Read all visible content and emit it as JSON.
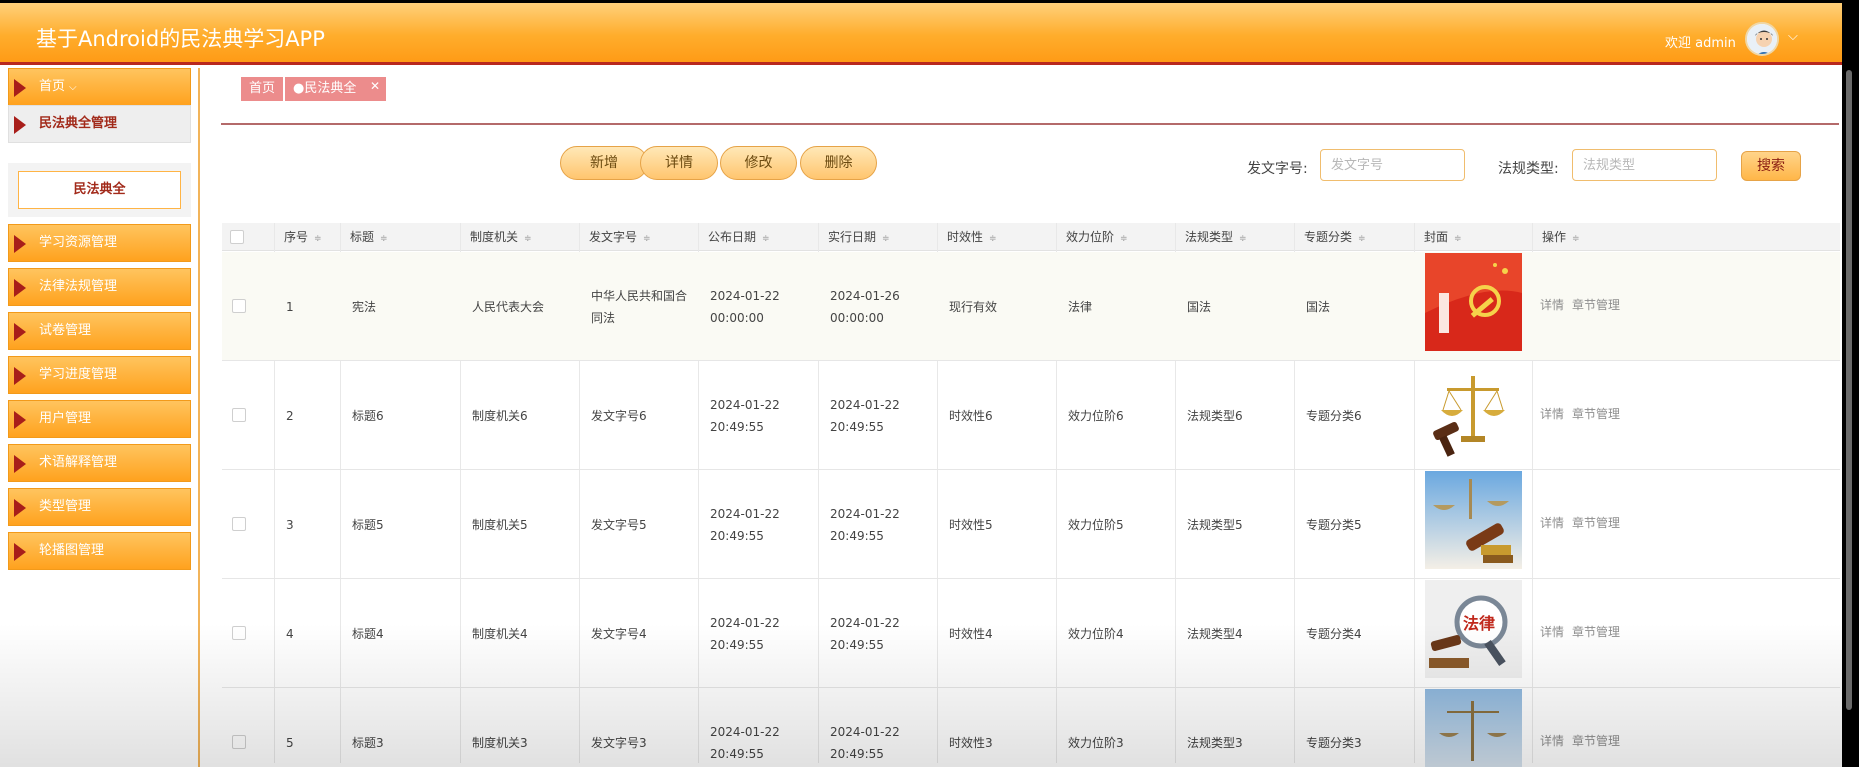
{
  "header": {
    "title": "基于Android的民法典学习APP",
    "welcome": "欢迎 admin",
    "caret": "⌵"
  },
  "sidebar": {
    "items": [
      {
        "label": "首页",
        "caret": "⌵"
      },
      {
        "label": "民法典全管理"
      },
      {
        "label": "学习资源管理"
      },
      {
        "label": "法律法规管理"
      },
      {
        "label": "试卷管理"
      },
      {
        "label": "学习进度管理"
      },
      {
        "label": "用户管理"
      },
      {
        "label": "术语解释管理"
      },
      {
        "label": "类型管理"
      },
      {
        "label": "轮播图管理"
      }
    ],
    "sub_item": "民法典全"
  },
  "breadcrumb": {
    "home": "首页",
    "current": "●民法典全",
    "close": "✕"
  },
  "toolbar": {
    "add": "新增",
    "detail": "详情",
    "edit": "修改",
    "delete": "删除"
  },
  "search": {
    "doc_no_label": "发文字号:",
    "doc_no_placeholder": "发文字号",
    "law_type_label": "法规类型:",
    "law_type_placeholder": "法规类型",
    "button": "搜索"
  },
  "table": {
    "columns": [
      "序号",
      "标题",
      "制度机关",
      "发文字号",
      "公布日期",
      "实行日期",
      "时效性",
      "效力位阶",
      "法规类型",
      "专题分类",
      "封面",
      "操作"
    ],
    "sort_icon": "≑",
    "op_detail": "详情",
    "op_chapter": "章节管理",
    "rows": [
      {
        "no": "1",
        "title": "宪法",
        "org": "人民代表大会",
        "docno": "中华人民共和国合同法",
        "pub": "2024-01-22 00:00:00",
        "impl": "2024-01-26 00:00:00",
        "valid": "现行有效",
        "level": "法律",
        "type": "国法",
        "topic": "国法"
      },
      {
        "no": "2",
        "title": "标题6",
        "org": "制度机关6",
        "docno": "发文字号6",
        "pub": "2024-01-22 20:49:55",
        "impl": "2024-01-22 20:49:55",
        "valid": "时效性6",
        "level": "效力位阶6",
        "type": "法规类型6",
        "topic": "专题分类6"
      },
      {
        "no": "3",
        "title": "标题5",
        "org": "制度机关5",
        "docno": "发文字号5",
        "pub": "2024-01-22 20:49:55",
        "impl": "2024-01-22 20:49:55",
        "valid": "时效性5",
        "level": "效力位阶5",
        "type": "法规类型5",
        "topic": "专题分类5"
      },
      {
        "no": "4",
        "title": "标题4",
        "org": "制度机关4",
        "docno": "发文字号4",
        "pub": "2024-01-22 20:49:55",
        "impl": "2024-01-22 20:49:55",
        "valid": "时效性4",
        "level": "效力位阶4",
        "type": "法规类型4",
        "topic": "专题分类4"
      },
      {
        "no": "5",
        "title": "标题3",
        "org": "制度机关3",
        "docno": "发文字号3",
        "pub": "2024-01-22 20:49:55",
        "impl": "2024-01-22 20:49:55",
        "valid": "时效性3",
        "level": "效力位阶3",
        "type": "法规类型3",
        "topic": "专题分类3"
      }
    ],
    "cover_4_text": "法律"
  },
  "colors": {
    "header_orange": "#ffad2c",
    "accent_red": "#b8281e",
    "tag_pink": "#ec8c8c"
  }
}
